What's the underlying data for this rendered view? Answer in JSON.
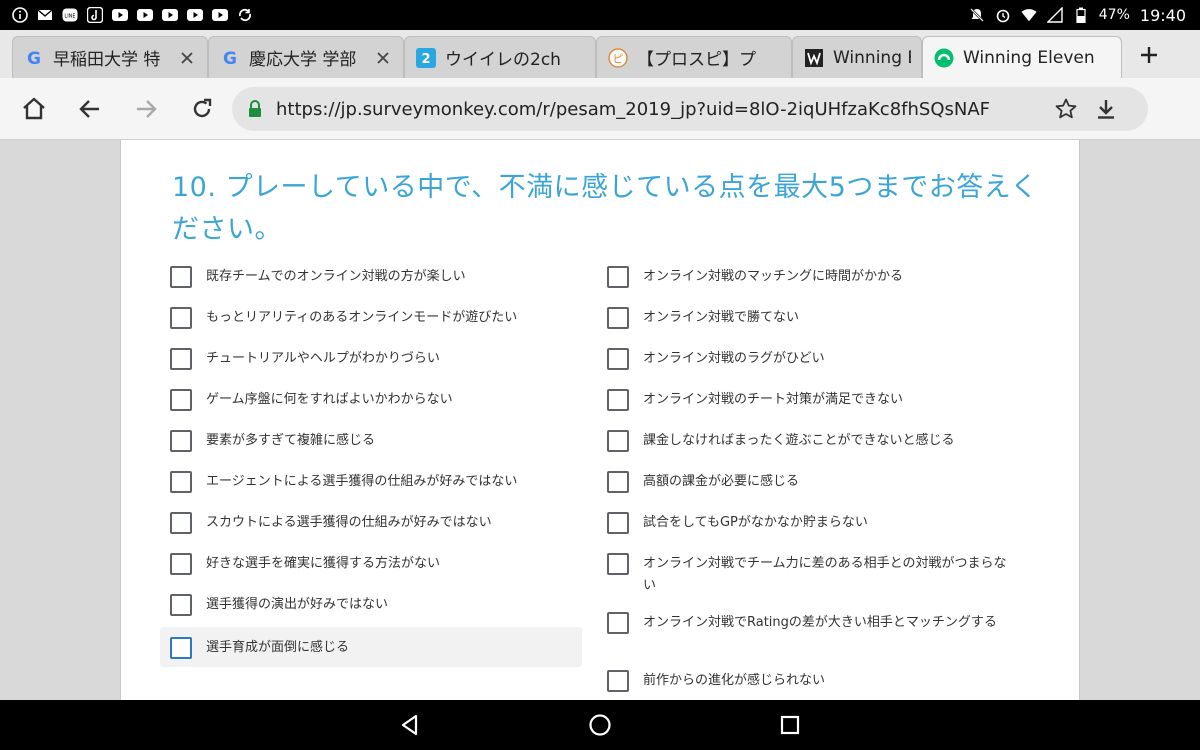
{
  "status_bar": {
    "battery_pct": "47%",
    "time": "19:40",
    "left_icons": [
      "info-icon",
      "mail-icon",
      "line-icon",
      "tiktok-icon",
      "youtube-icon",
      "youtube-icon",
      "youtube-icon",
      "youtube-icon",
      "youtube-icon",
      "sync-icon"
    ],
    "right_icons": [
      "mute-icon",
      "alarm-icon",
      "wifi-icon",
      "signal-icon",
      "battery-icon"
    ]
  },
  "tabs": [
    {
      "title": "早稲田大学 特",
      "favicon": "G",
      "fav_color": "#4285F4"
    },
    {
      "title": "慶応大学 学部",
      "favicon": "G",
      "fav_color": "#4285F4"
    },
    {
      "title": "ウイイレの2ch",
      "favicon": "2",
      "fav_color": "#2aa7e0"
    },
    {
      "title": "【プロスピ】プ",
      "favicon": "ピ",
      "fav_color": "#e08a3a"
    },
    {
      "title": "Winning Eleven",
      "favicon": "W",
      "fav_color": "#222222"
    },
    {
      "title": "Winning Eleven",
      "favicon": "✓",
      "fav_color": "#00bf6f",
      "active": true
    }
  ],
  "toolbar": {
    "url": "https://jp.surveymonkey.com/r/pesam_2019_jp?uid=8lO-2iqUHfzaKc8fhSQsNAF"
  },
  "question": {
    "title": "10. プレーしている中で、不満に感じている点を最大5つまでお答えください。"
  },
  "options_left": [
    "既存チームでのオンライン対戦の方が楽しい",
    "もっとリアリティのあるオンラインモードが遊びたい",
    "チュートリアルやヘルプがわかりづらい",
    "ゲーム序盤に何をすればよいかわからない",
    "要素が多すぎて複雑に感じる",
    "エージェントによる選手獲得の仕組みが好みではない",
    "スカウトによる選手獲得の仕組みが好みではない",
    "好きな選手を確実に獲得する方法がない",
    "選手獲得の演出が好みではない",
    "選手育成が面倒に感じる"
  ],
  "options_right": [
    "オンライン対戦のマッチングに時間がかかる",
    "オンライン対戦で勝てない",
    "オンライン対戦のラグがひどい",
    "オンライン対戦のチート対策が満足できない",
    "課金しなければまったく遊ぶことができないと感じる",
    "高額の課金が必要に感じる",
    "試合をしてもGPがなかなか貯まらない",
    "オンライン対戦でチーム力に差のある相手との対戦がつまらない",
    "オンライン対戦でRatingの差が大きい相手とマッチングする",
    "前作からの進化が感じられない"
  ],
  "colors": {
    "question": "#3aa5d6",
    "focus_checkbox": "#2b7bb8",
    "secure_lock": "#1e8e3e"
  }
}
